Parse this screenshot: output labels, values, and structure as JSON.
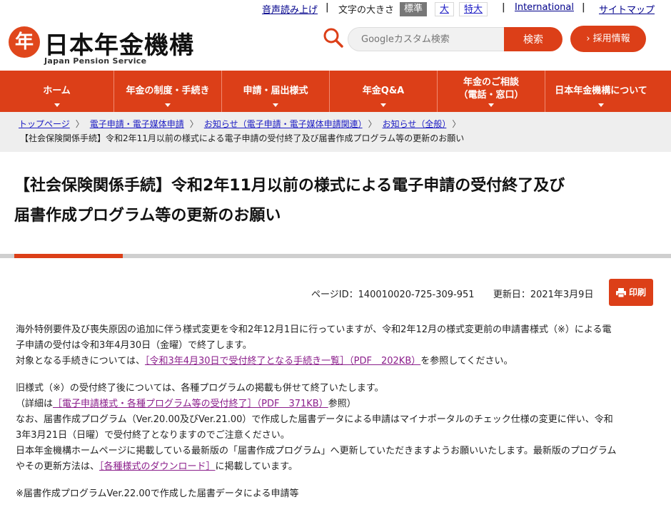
{
  "util": {
    "audio": "音声読み上げ",
    "sep": "|",
    "font_size_label": "文字の大きさ",
    "fs_standard": "標準",
    "fs_large": "大",
    "fs_xlarge": "特大",
    "international": "International",
    "sitemap": "サイトマップ"
  },
  "header": {
    "logo_glyph": "年",
    "logo_text": "日本年金機構",
    "logo_sub": "Japan Pension Service",
    "search_placeholder": "Googleカスタム検索",
    "search_button": "検索",
    "recruit_button": "› 採用情報"
  },
  "nav": [
    {
      "label": "ホーム"
    },
    {
      "label": "年金の制度・手続き"
    },
    {
      "label": "申請・届出様式"
    },
    {
      "label": "年金Q&A"
    },
    {
      "label": "年金のご相談\n（電話・窓口）"
    },
    {
      "label": "日本年金機構について"
    }
  ],
  "breadcrumb": {
    "items": [
      "トップページ",
      "電子申請・電子媒体申請",
      "お知らせ（電子申請・電子媒体申請関連）",
      "お知らせ（全般）"
    ],
    "sep": "〉",
    "current": "【社会保険関係手続】令和2年11月以前の様式による電子申請の受付終了及び届書作成プログラム等の更新のお願い"
  },
  "page": {
    "title_line1": "【社会保険関係手続】令和2年11月以前の様式による電子申請の受付終了及び",
    "title_line2": "届書作成プログラム等の更新のお願い",
    "page_id": "ページID：140010020-725-309-951",
    "updated": "更新日：2021年3月9日",
    "print": "印刷"
  },
  "content": {
    "p1_line1": "海外特例要件及び喪失原因の追加に伴う様式変更を令和2年12月1日に行っていますが、令和2年12月の様式変更前の申請書様式（※）による電",
    "p1_line2": "子申請の受付は令和3年4月30日（金曜）で終了します。",
    "p2_prefix": "対象となる手続きについては、",
    "p2_link": "［令和3年4月30日で受付終了となる手続き一覧］（PDF　202KB）",
    "p2_suffix": "を参照してください。",
    "p3_line1": "旧様式（※）の受付終了後については、各種プログラムの掲載も併せて終了いたします。",
    "p3_l2_prefix": "（詳細は",
    "p3_l2_link": "［電子申請様式・各種プログラム等の受付終了］（PDF　371KB）",
    "p3_l2_suffix": "参照）",
    "p3_line3": "なお、届書作成プログラム（Ver.20.00及びVer.21.00）で作成した届書データによる申請はマイナポータルのチェック仕様の変更に伴い、令和",
    "p3_line4": "3年3月21日（日曜）で受付終了となりますのでご注意ください。",
    "p3_line5": "日本年金機構ホームページに掲載している最新版の「届書作成プログラム」へ更新していただきますようお願いいたします。最新版のプログラム",
    "p3_l6_prefix": "やその更新方法は、",
    "p3_l6_link": "［各種様式のダウンロード］",
    "p3_l6_suffix": "に掲載しています。",
    "p4": "※届書作成プログラムVer.22.00で作成した届書データによる申請等"
  },
  "colors": {
    "brand": "#dc3f18",
    "link": "#1b1bc4",
    "visited_link": "#8b1e8b"
  }
}
